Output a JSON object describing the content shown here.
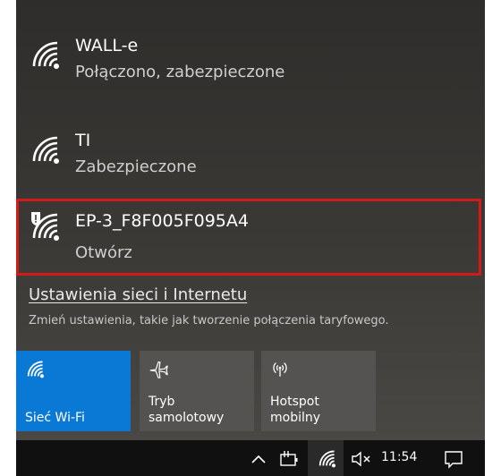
{
  "networks": [
    {
      "name": "WALL-e",
      "status": "Połączono, zabezpieczone",
      "icon": "wifi-icon"
    },
    {
      "name": "TI",
      "status": "Zabezpieczone",
      "icon": "wifi-icon"
    },
    {
      "name": "EP-3_F8F005F095A4",
      "status": "Otwórz",
      "icon": "wifi-open-warning-icon"
    }
  ],
  "settings": {
    "link": "Ustawienia sieci i Internetu",
    "description": "Zmień ustawienia, takie jak tworzenie połączenia taryfowego."
  },
  "tiles": [
    {
      "label": "Sieć Wi-Fi",
      "icon": "wifi-icon",
      "active": true
    },
    {
      "label": "Tryb\nsamolotowy",
      "line1": "Tryb",
      "line2": "samolotowy",
      "icon": "airplane-icon",
      "active": false
    },
    {
      "label": "Hotspot\nmobilny",
      "line1": "Hotspot",
      "line2": "mobilny",
      "icon": "hotspot-icon",
      "active": false
    }
  ],
  "taskbar": {
    "time": "11:54",
    "icons": [
      "chevron-up-icon",
      "battery-plug-icon",
      "wifi-icon",
      "volume-muted-icon",
      "notification-icon"
    ]
  },
  "colors": {
    "accent": "#0a79d6",
    "highlight_border": "#d11a1a",
    "panel": "#3a3936",
    "taskbar": "#101010"
  }
}
